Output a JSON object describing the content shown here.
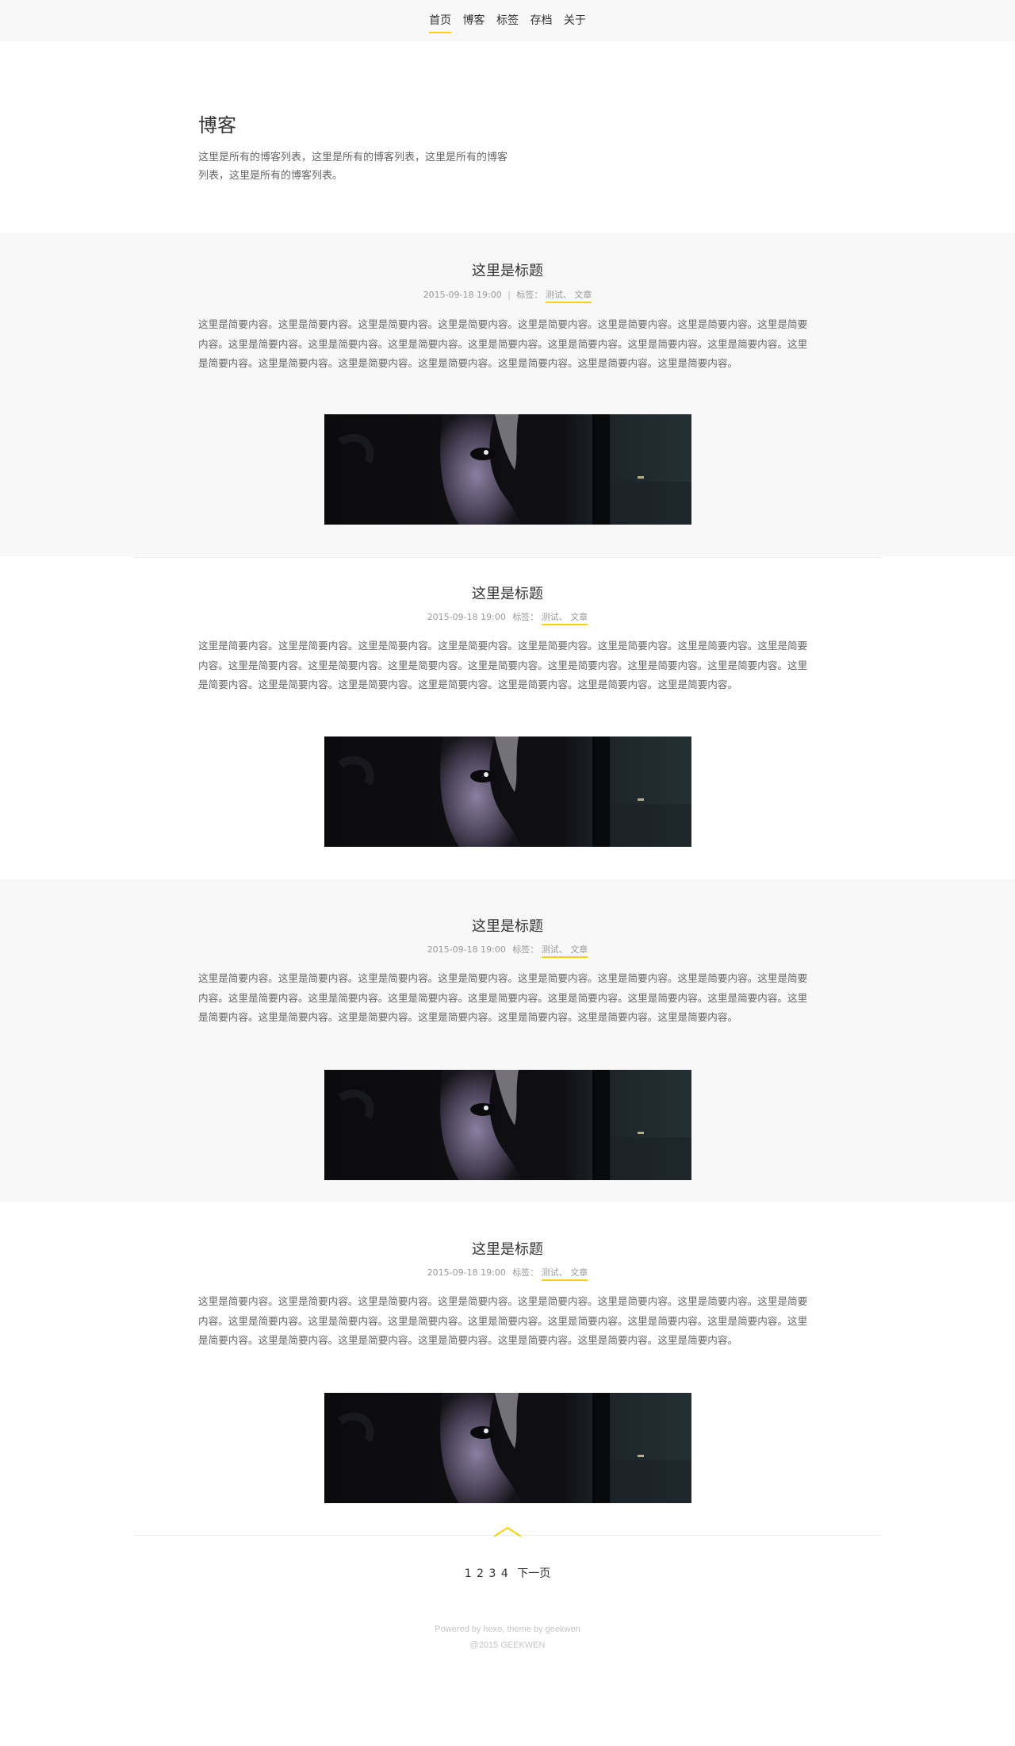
{
  "nav": {
    "items": [
      {
        "label": "首页",
        "active": true
      },
      {
        "label": "博客",
        "active": false
      },
      {
        "label": "标签",
        "active": false
      },
      {
        "label": "存档",
        "active": false
      },
      {
        "label": "关于",
        "active": false
      }
    ]
  },
  "header": {
    "title": "博客",
    "description": "这里是所有的博客列表，这里是所有的博客列表，这里是所有的博客列表，这里是所有的博客列表。"
  },
  "posts": [
    {
      "title": "这里是标题",
      "date": "2015-09-18 19:00",
      "separator": "|",
      "tags_label": "标签：",
      "tag1": "测试、",
      "tag2": "文章",
      "excerpt": "这里是简要内容。这里是简要内容。这里是简要内容。这里是简要内容。这里是简要内容。这里是简要内容。这里是简要内容。这里是简要内容。这里是简要内容。这里是简要内容。这里是简要内容。这里是简要内容。这里是简要内容。这里是简要内容。这里是简要内容。这里是简要内容。这里是简要内容。这里是简要内容。这里是简要内容。这里是简要内容。这里是简要内容。这里是简要内容。"
    },
    {
      "title": "这里是标题",
      "date": "2015-09-18 19:00",
      "separator": "",
      "tags_label": "标签：",
      "tag1": "测试、",
      "tag2": "文章",
      "excerpt": "这里是简要内容。这里是简要内容。这里是简要内容。这里是简要内容。这里是简要内容。这里是简要内容。这里是简要内容。这里是简要内容。这里是简要内容。这里是简要内容。这里是简要内容。这里是简要内容。这里是简要内容。这里是简要内容。这里是简要内容。这里是简要内容。这里是简要内容。这里是简要内容。这里是简要内容。这里是简要内容。这里是简要内容。这里是简要内容。"
    },
    {
      "title": "这里是标题",
      "date": "2015-09-18 19:00",
      "separator": "",
      "tags_label": "标签：",
      "tag1": "测试、",
      "tag2": "文章",
      "excerpt": "这里是简要内容。这里是简要内容。这里是简要内容。这里是简要内容。这里是简要内容。这里是简要内容。这里是简要内容。这里是简要内容。这里是简要内容。这里是简要内容。这里是简要内容。这里是简要内容。这里是简要内容。这里是简要内容。这里是简要内容。这里是简要内容。这里是简要内容。这里是简要内容。这里是简要内容。这里是简要内容。这里是简要内容。这里是简要内容。"
    },
    {
      "title": "这里是标题",
      "date": "2015-09-18 19:00",
      "separator": "",
      "tags_label": "标签：",
      "tag1": "测试、",
      "tag2": "文章",
      "excerpt": "这里是简要内容。这里是简要内容。这里是简要内容。这里是简要内容。这里是简要内容。这里是简要内容。这里是简要内容。这里是简要内容。这里是简要内容。这里是简要内容。这里是简要内容。这里是简要内容。这里是简要内容。这里是简要内容。这里是简要内容。这里是简要内容。这里是简要内容。这里是简要内容。这里是简要内容。这里是简要内容。这里是简要内容。这里是简要内容。"
    }
  ],
  "pagination": {
    "pages": [
      "1",
      "2",
      "3",
      "4"
    ],
    "next_label": "下一页"
  },
  "footer": {
    "powered": "Powered by hexo, theme by geekwen",
    "copyright": "@2015  GEEKWEN"
  },
  "colors": {
    "accent": "#f5d20e",
    "nav_bg": "#f8f8f8",
    "alt_section_bg": "#f8f8f8"
  }
}
